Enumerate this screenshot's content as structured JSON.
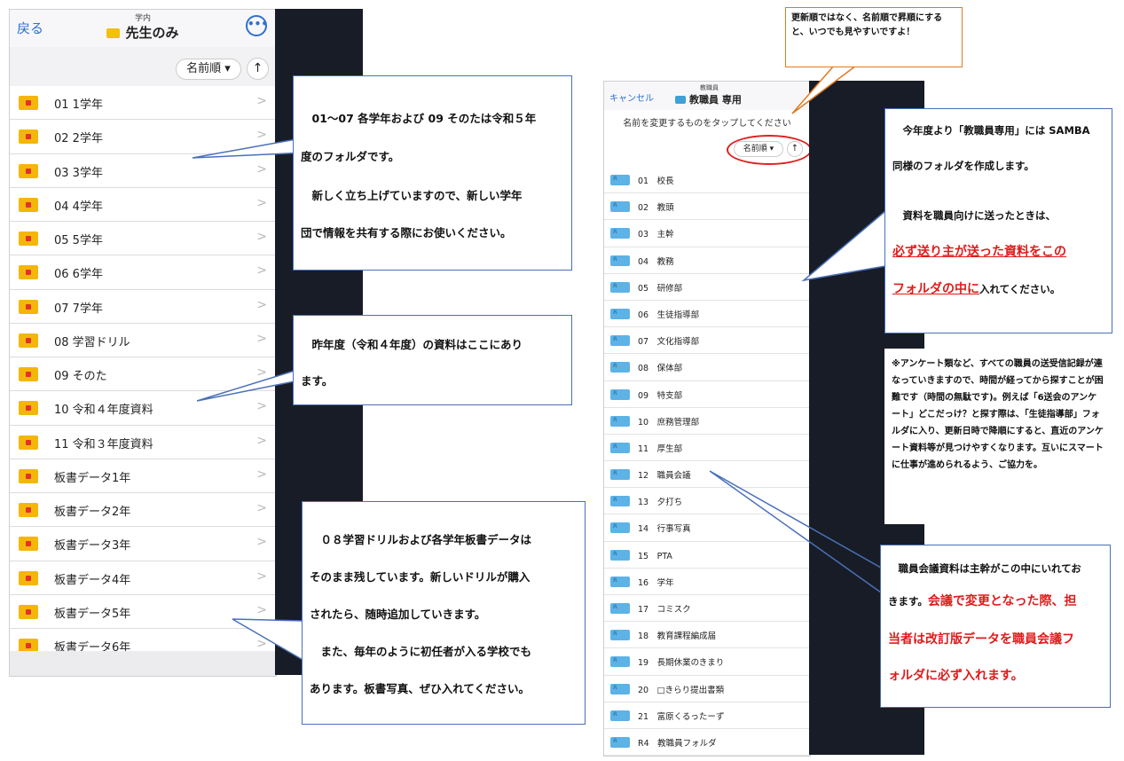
{
  "left_screen": {
    "back": "戻る",
    "subtitle": "学内",
    "title": "先生のみ",
    "sort_label": "名前順 ▾",
    "sort_dir": "↑",
    "folders": [
      "01 1学年",
      "02 2学年",
      "03 3学年",
      "04 4学年",
      "05 5学年",
      "06 6学年",
      "07 7学年",
      "08 学習ドリル",
      "09 そのた",
      "10 令和４年度資料",
      "11 令和３年度資料",
      "板書データ1年",
      "板書データ2年",
      "板書データ3年",
      "板書データ4年",
      "板書データ5年",
      "板書データ6年"
    ]
  },
  "right_screen": {
    "cancel": "キャンセル",
    "subtitle": "教職員",
    "title": "教職員 専用",
    "instruction": "名前を変更するものをタップしてください",
    "sort_label": "名前順 ▾",
    "sort_dir": "↑",
    "folders": [
      "01　校長",
      "02　教頭",
      "03　主幹",
      "04　教務",
      "05　研修部",
      "06　生徒指導部",
      "07　文化指導部",
      "08　保体部",
      "09　特支部",
      "10　庶務管理部",
      "11　厚生部",
      "12　職員会議",
      "13　夕打ち",
      "14　行事写真",
      "15　PTA",
      "16　学年",
      "17　コミスク",
      "18　教育課程編成届",
      "19　長期休業のきまり",
      "20　□きらり提出書類",
      "21　富原くるったーず",
      "R4　教職員フォルダ"
    ]
  },
  "callouts": {
    "c1": [
      "01～07 各学年および 09 そのたは令和５年",
      "度のフォルダです。",
      "新しく立ち上げていますので、新しい学年",
      "団で情報を共有する際にお使いください。"
    ],
    "c2": [
      "昨年度（令和４年度）の資料はここにあり",
      "ます。"
    ],
    "c3": [
      "０８学習ドリルおよび各学年板書データは",
      "そのまま残しています。新しいドリルが購入",
      "されたら、随時追加していきます。",
      "また、毎年のように初任者が入る学校でも",
      "あります。板書写真、ぜひ入れてください。"
    ],
    "top": "更新順ではなく、名前順で昇順にすると、いつでも見やすいですよ！",
    "r1": [
      "今年度より「教職員専用」には SAMBA",
      "同様のフォルダを作成します。",
      "資料を職員向けに送ったときは、",
      "必ず送り主が送った資料をこの",
      "フォルダの中に",
      "入れてください。"
    ],
    "r2": "※アンケート類など、すべての職員の送受信記録が連なっていきますので、時間が経ってから探すことが困難です（時間の無駄です)。例えば「6送会のアンケート」どこだっけ？と探す際は、「生徒指導部」フォルダに入り、更新日時で降順にすると、直近のアンケート資料等が見つけやすくなります。互いにスマートに仕事が進められるよう、ご協力を。",
    "r3": [
      "職員会議資料は主幹がこの中にいれてお",
      "きます。",
      "会議で変更となった際、担",
      "当者は改訂版データを職員会議フ",
      "ォルダに必ず入れます。"
    ]
  },
  "colors": {
    "accent_blue": "#2f6fd0",
    "callout_border": "#4a70b8",
    "highlight_red": "#e01b1b",
    "folder_yellow": "#f5b60a",
    "folder_blue": "#5db2e6"
  }
}
